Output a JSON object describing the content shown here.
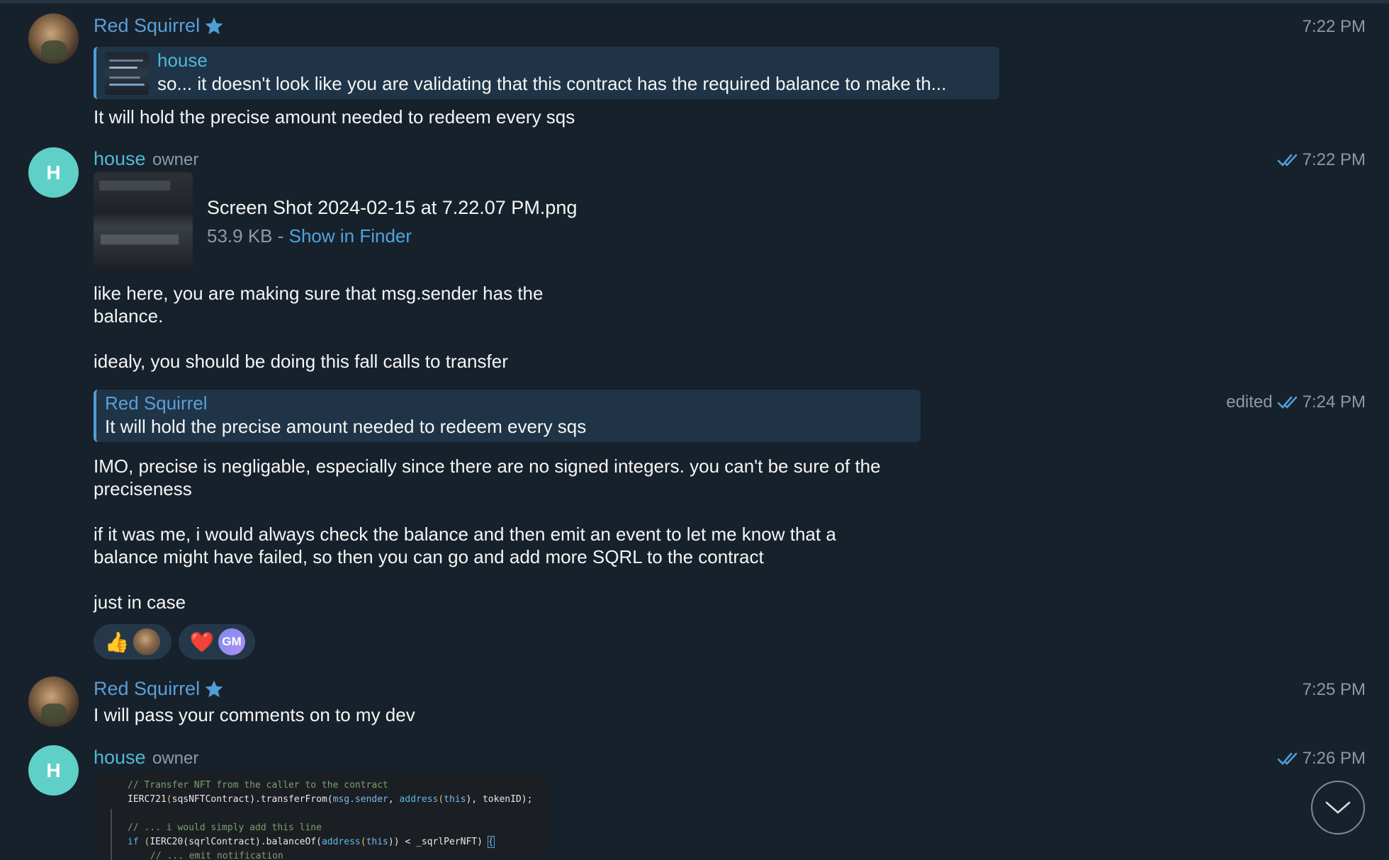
{
  "messages": [
    {
      "sender": "Red Squirrel",
      "time": "7:22 PM",
      "reply": {
        "name": "house",
        "text": "so... it doesn't look like you are validating that this contract has the required balance to make th..."
      },
      "text": "It will hold the precise amount needed to redeem every sqs"
    },
    {
      "sender": "house",
      "role": "owner",
      "time": "7:22 PM",
      "file": {
        "name": "Screen Shot 2024-02-15 at 7.22.07 PM.png",
        "size": "53.9 KB",
        "separator": " - ",
        "link": "Show in Finder"
      },
      "text": "like here, you are making sure that msg.sender has the\nbalance.\n\nidealy, you should be doing this fall calls to transfer"
    },
    {
      "time_prefix": "edited",
      "time": "7:24 PM",
      "reply": {
        "name": "Red Squirrel",
        "text": "It will hold the precise amount needed to redeem every sqs"
      },
      "text": "IMO, precise is negligable, especially since there are no signed integers. you can't be sure of the\npreciseness\n\nif it was me, i would always check the balance and then emit an event to let me know that a\nbalance might have failed, so then you can go and add more SQRL to the contract\n\njust in case",
      "reactions": [
        {
          "emoji": "👍",
          "avatar": "red-squirrel"
        },
        {
          "emoji": "❤️",
          "avatar": "GM"
        }
      ]
    },
    {
      "sender": "Red Squirrel",
      "time": "7:25 PM",
      "text": "I will pass your comments on to my dev"
    },
    {
      "sender": "house",
      "role": "owner",
      "time": "7:26 PM",
      "code": {
        "line1": "// Transfer NFT from the caller to the contract",
        "line2a": "IERC721",
        "line2b": "(",
        "line2c": "sqsNFTContract",
        "line2d": ").transferFrom(",
        "line2e": "msg.sender",
        "line2f": ", ",
        "line2g": "address",
        "line2h": "(",
        "line2i": "this",
        "line2j": "), tokenID);",
        "line3": "// ... i would simply add this line",
        "line4a": "if",
        "line4b": " (",
        "line4c": "IERC20",
        "line4d": "(sqrlContract).balanceOf(",
        "line4e": "address",
        "line4f": "(",
        "line4g": "this",
        "line4h": ")) < _sqrlPerNFT) ",
        "line4i": "{",
        "line5": "// ... emit notification"
      }
    }
  ],
  "colors": {
    "background": "#17212b",
    "accent": "#5a9fd8",
    "house_name": "#4fb9d7",
    "muted": "#8d99a6"
  },
  "icons": [
    "star-icon",
    "double-check-icon",
    "chevron-down-icon"
  ]
}
